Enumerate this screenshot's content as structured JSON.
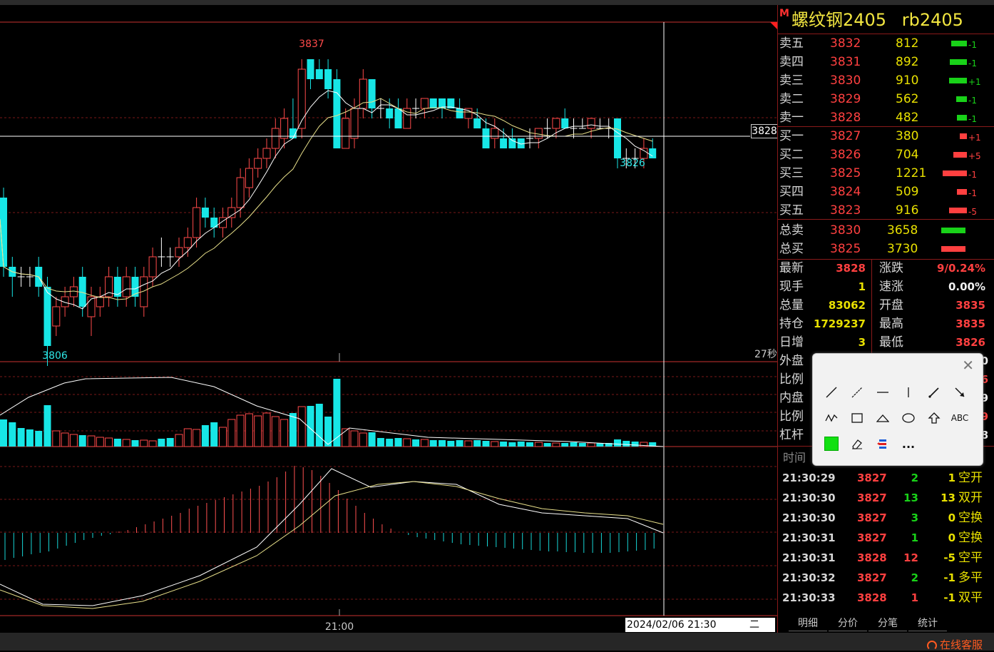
{
  "instrument": {
    "name": "螺纹钢2405",
    "code": "rb2405",
    "mark": "M"
  },
  "chart_labels": {
    "high": "3837",
    "low": "3806",
    "last_low": "3826",
    "price_marker": "3828",
    "countdown": "27秒",
    "time_tick": "21:00",
    "cursor_time": "2024/02/06 21:30",
    "weekday": "二"
  },
  "depth": {
    "asks": [
      {
        "label": "卖五",
        "price": "3832",
        "vol": "812",
        "chg": "-1",
        "bar": 0.28
      },
      {
        "label": "卖四",
        "price": "3831",
        "vol": "892",
        "chg": "-1",
        "bar": 0.3
      },
      {
        "label": "卖三",
        "price": "3830",
        "vol": "910",
        "chg": "+1",
        "bar": 0.31
      },
      {
        "label": "卖二",
        "price": "3829",
        "vol": "562",
        "chg": "-1",
        "bar": 0.19
      },
      {
        "label": "卖一",
        "price": "3828",
        "vol": "482",
        "chg": "-1",
        "bar": 0.17
      }
    ],
    "bids": [
      {
        "label": "买一",
        "price": "3827",
        "vol": "380",
        "chg": "+1",
        "bar": 0.13
      },
      {
        "label": "买二",
        "price": "3826",
        "vol": "704",
        "chg": "+5",
        "bar": 0.24
      },
      {
        "label": "买三",
        "price": "3825",
        "vol": "1221",
        "chg": "-1",
        "bar": 0.42
      },
      {
        "label": "买四",
        "price": "3824",
        "vol": "509",
        "chg": "-1",
        "bar": 0.17
      },
      {
        "label": "买五",
        "price": "3823",
        "vol": "916",
        "chg": "-5",
        "bar": 0.31
      }
    ],
    "total_sell": {
      "label": "总卖",
      "price": "3830",
      "vol": "3658"
    },
    "total_buy": {
      "label": "总买",
      "price": "3825",
      "vol": "3730"
    }
  },
  "stats": {
    "latest": {
      "label": "最新",
      "value": "3828"
    },
    "change": {
      "label": "涨跌",
      "value": "9/0.24%"
    },
    "hand": {
      "label": "现手",
      "value": "1"
    },
    "speed": {
      "label": "速涨",
      "value": "0.00%"
    },
    "volume": {
      "label": "总量",
      "value": "83062"
    },
    "open": {
      "label": "开盘",
      "value": "3835"
    },
    "oi": {
      "label": "持仓",
      "value": "1729237"
    },
    "high": {
      "label": "最高",
      "value": "3835"
    },
    "daily_inc": {
      "label": "日增",
      "value": "3"
    },
    "low": {
      "label": "最低",
      "value": "3826"
    },
    "outer": {
      "label": "外盘",
      "value": "0"
    },
    "ratio1": {
      "label": "比例",
      "value": "6"
    },
    "inner": {
      "label": "内盘",
      "value": "9"
    },
    "ratio2": {
      "label": "比例",
      "value": "9"
    },
    "leverage": {
      "label": "杠杆",
      "value": "8"
    }
  },
  "ticks_header": "时间",
  "ticks": [
    {
      "time": "21:30:29",
      "price": "3827",
      "vol": "2",
      "oi": "1",
      "type": "空开",
      "pc": "red",
      "vc": "green",
      "oc": "yellow"
    },
    {
      "time": "21:30:30",
      "price": "3827",
      "vol": "13",
      "oi": "13",
      "type": "双开",
      "pc": "red",
      "vc": "green",
      "oc": "yellow"
    },
    {
      "time": "21:30:30",
      "price": "3827",
      "vol": "3",
      "oi": "0",
      "type": "空换",
      "pc": "red",
      "vc": "green",
      "oc": "yellow"
    },
    {
      "time": "21:30:31",
      "price": "3827",
      "vol": "1",
      "oi": "0",
      "type": "空换",
      "pc": "red",
      "vc": "green",
      "oc": "yellow"
    },
    {
      "time": "21:30:31",
      "price": "3828",
      "vol": "12",
      "oi": "-5",
      "type": "空平",
      "pc": "red",
      "vc": "red",
      "oc": "yellow"
    },
    {
      "time": "21:30:32",
      "price": "3827",
      "vol": "2",
      "oi": "-1",
      "type": "多平",
      "pc": "red",
      "vc": "green",
      "oc": "yellow"
    },
    {
      "time": "21:30:33",
      "price": "3828",
      "vol": "1",
      "oi": "-1",
      "type": "双平",
      "pc": "red",
      "vc": "red",
      "oc": "yellow"
    }
  ],
  "tabs": [
    "明细",
    "分价",
    "分笔",
    "统计"
  ],
  "toolbox": {
    "text_tool": "ABC",
    "more": "..."
  },
  "service": "在线客服",
  "colors": {
    "up": "#ff4040",
    "down": "#17e6e6",
    "panel_border": "#8a1a1a"
  }
}
